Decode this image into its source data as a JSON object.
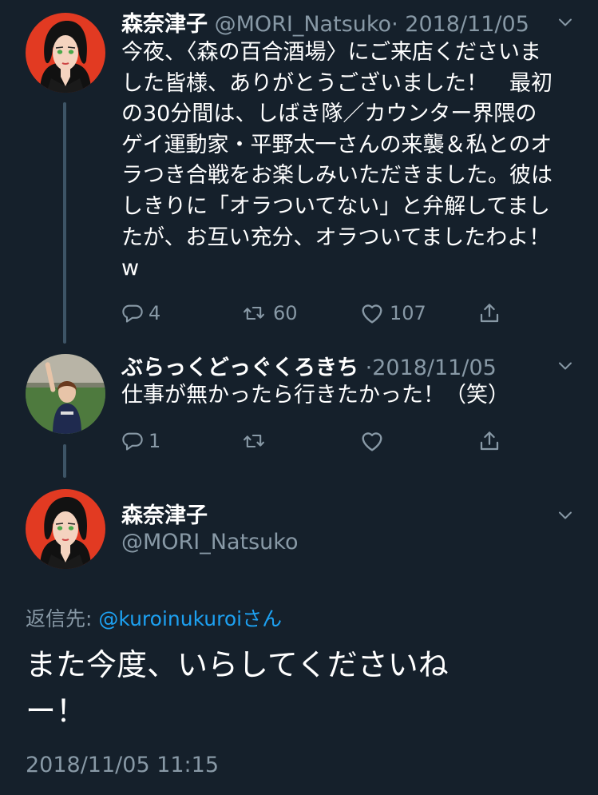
{
  "tweets": [
    {
      "display_name": "森奈津子",
      "handle": "@MORI_Natsuko",
      "sep": "·",
      "date": "2018/11/05",
      "lines": [
        "今夜、〈森の百合酒場〉にご来店くださいま",
        "した皆様、ありがとうございました！　最初",
        "の30分間は、しばき隊／カウンター界隈の",
        "ゲイ運動家・平野太一さんの来襲＆私とのオ",
        "ラつき合戦をお楽しみいただきました。彼は",
        "しきりに「オラついてない」と弁解してまし",
        "たが、お互い充分、オラついてましたわよ！",
        "w"
      ],
      "reply_count": "4",
      "retweet_count": "60",
      "like_count": "107"
    },
    {
      "display_name": "ぶらっくどっぐくろきち",
      "sep": "·",
      "date": "2018/11/05",
      "lines": [
        "仕事が無かったら行きたかった！（笑）"
      ],
      "reply_count": "1",
      "retweet_count": "",
      "like_count": ""
    }
  ],
  "focus": {
    "display_name": "森奈津子",
    "handle": "@MORI_Natsuko",
    "reply_prefix": "返信先: ",
    "reply_to": "@kuroinukuroi",
    "reply_suffix": "さん",
    "lines": [
      "また今度、いらしてくださいね",
      "ー！"
    ],
    "timestamp": "2018/11/05 11:15"
  },
  "icons": [
    "reply-icon",
    "retweet-icon",
    "like-icon",
    "share-icon",
    "chevron-down-icon"
  ],
  "colors": {
    "background": "#15202b",
    "muted": "#8899a6",
    "link": "#1da1f2",
    "thread_line": "#3d5466"
  }
}
